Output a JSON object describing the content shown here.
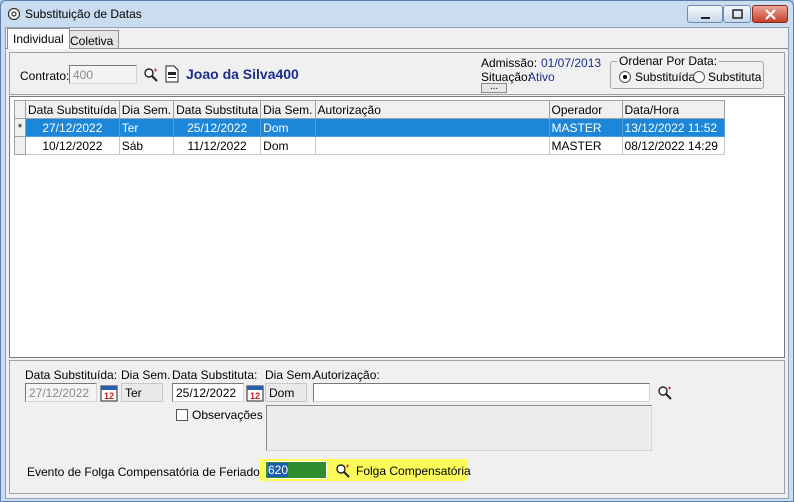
{
  "window": {
    "title": "Substituição de Datas"
  },
  "tabs": [
    {
      "label": "Individual",
      "active": true
    },
    {
      "label": "Coletiva",
      "active": false
    }
  ],
  "header": {
    "contrato_label": "Contrato:",
    "contrato_value": "400",
    "employee_name": "Joao da Silva400",
    "admissao_label": "Admissão:",
    "admissao_value": "01/07/2013",
    "situacao_label": "Situação:",
    "situacao_value": "Ativo",
    "more_button": "...",
    "order_title": "Ordenar Por Data:",
    "order_options": [
      "Substituída",
      "Substituta"
    ],
    "order_selected": "Substituída"
  },
  "grid": {
    "columns": [
      "Data Substituída",
      "Dia Sem.",
      "Data Substituta",
      "Dia Sem.",
      "Autorização",
      "Operador",
      "Data/Hora"
    ],
    "rows": [
      {
        "indicator": "*",
        "data_substituida": "27/12/2022",
        "dia_sem_1": "Ter",
        "data_substituta": "25/12/2022",
        "dia_sem_2": "Dom",
        "autorizacao": "",
        "operador": "MASTER",
        "data_hora": "13/12/2022 11:52"
      },
      {
        "indicator": "",
        "data_substituida": "10/12/2022",
        "dia_sem_1": "Sáb",
        "data_substituta": "11/12/2022",
        "dia_sem_2": "Dom",
        "autorizacao": "",
        "operador": "MASTER",
        "data_hora": "08/12/2022 14:29"
      }
    ]
  },
  "detail": {
    "data_substituida_label": "Data Substituída:",
    "data_substituida_value": "27/12/2022",
    "dia_sem_label_1": "Dia Sem.",
    "dia_sem_value_1": "Ter",
    "data_substituta_label": "Data Substituta:",
    "data_substituta_value": "25/12/2022",
    "dia_sem_label_2": "Dia Sem.",
    "dia_sem_value_2": "Dom",
    "autorizacao_label": "Autorização:",
    "autorizacao_value": "",
    "observacoes_label": "Observações",
    "evento_label": "Evento de Folga Compensatória de Feriado:",
    "evento_value": "620",
    "evento_description": "Folga Compensatória"
  },
  "colors": {
    "selection": "#1c87d8",
    "name_text": "#1a2f8c",
    "highlight": "#fbfb5a"
  }
}
